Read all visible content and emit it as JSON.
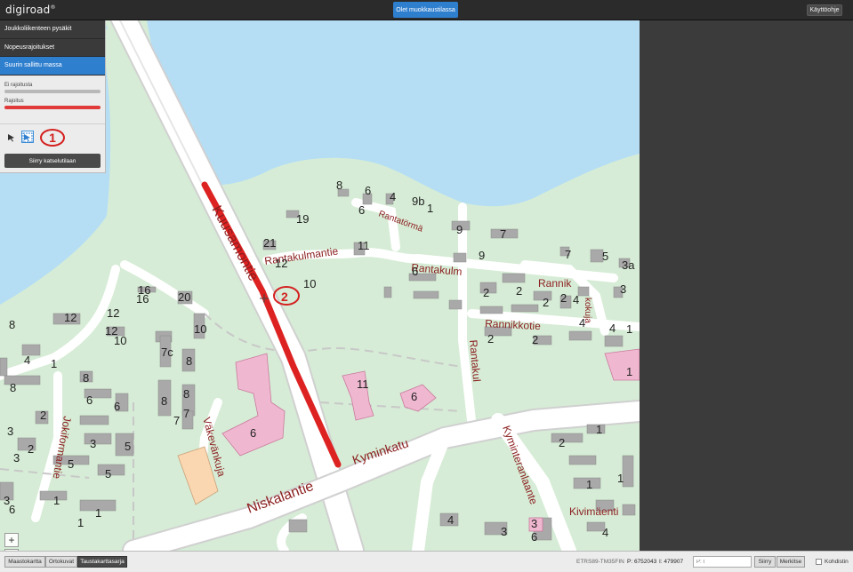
{
  "header": {
    "logo": "digiroad",
    "logo_mark": "®",
    "edit_mode_label": "Olet muokkaustilassa",
    "help_label": "Käyttöohje"
  },
  "panel": {
    "layers": [
      {
        "label": "Joukkoliikenteen pysäkit",
        "active": false
      },
      {
        "label": "Nopeusrajoitukset",
        "active": false
      },
      {
        "label": "Suurin sallittu massa",
        "active": true
      }
    ],
    "legend": [
      {
        "label": "Ei rajoitusta",
        "color": "#b8b8b8"
      },
      {
        "label": "Rajoitus",
        "color": "#e03a3a"
      }
    ],
    "marker_1": "1",
    "view_mode_label": "Siirry katselutilaan"
  },
  "map": {
    "marker_2": "2",
    "zoom_in": "+",
    "zoom_out": "−",
    "street_names": [
      "Kuusamontie",
      "Rantakulmantie",
      "Rantakulm",
      "Rannikkotie",
      "Rannik",
      "kokuja",
      "Rantakul",
      "Kyminkatu",
      "Niskalantie",
      "Kyminteranlaante",
      "Kivimäenti",
      "Väkevänkuja",
      "Jokiformantie",
      "Rantatörmä"
    ],
    "house_numbers": [
      "8",
      "6",
      "4",
      "9b",
      "1",
      "6",
      "19",
      "9",
      "7",
      "21",
      "11",
      "12",
      "9",
      "7",
      "5",
      "3a",
      "10",
      "6",
      "2",
      "2",
      "2",
      "4",
      "3",
      "16",
      "16",
      "20",
      "12",
      "12",
      "12",
      "10",
      "8",
      "4",
      "1",
      "7c",
      "10",
      "8",
      "8",
      "8",
      "8",
      "8",
      "6",
      "6",
      "7",
      "7",
      "11",
      "6",
      "6",
      "2",
      "2",
      "1",
      "2",
      "3",
      "5",
      "5",
      "5",
      "3",
      "3",
      "1",
      "1",
      "1",
      "1",
      "1",
      "4",
      "3",
      "3",
      "4",
      "4",
      "1",
      "2",
      "2",
      "1",
      "6",
      "2",
      "4",
      "3",
      "6"
    ]
  },
  "bottom": {
    "basemaps": [
      {
        "label": "Maastokartta",
        "active": false
      },
      {
        "label": "Ortokuvat",
        "active": false
      },
      {
        "label": "Taustakarttasarja",
        "active": true
      }
    ],
    "crs_label": "ETRS89-TM35FIN",
    "p_coord": "P: 6752043",
    "i_coord": "I: 479907",
    "coord_input_placeholder": "P: I",
    "move_label": "Siirry",
    "mark_label": "Merkitse",
    "crosshair_label": "Kohdistin"
  },
  "colors": {
    "water": "#b5def5",
    "land": "#d6ecd6",
    "road": "#ffffff",
    "building": "#a9a9a9",
    "highlight": "#dd2222",
    "accent": "#2f7fcf"
  }
}
